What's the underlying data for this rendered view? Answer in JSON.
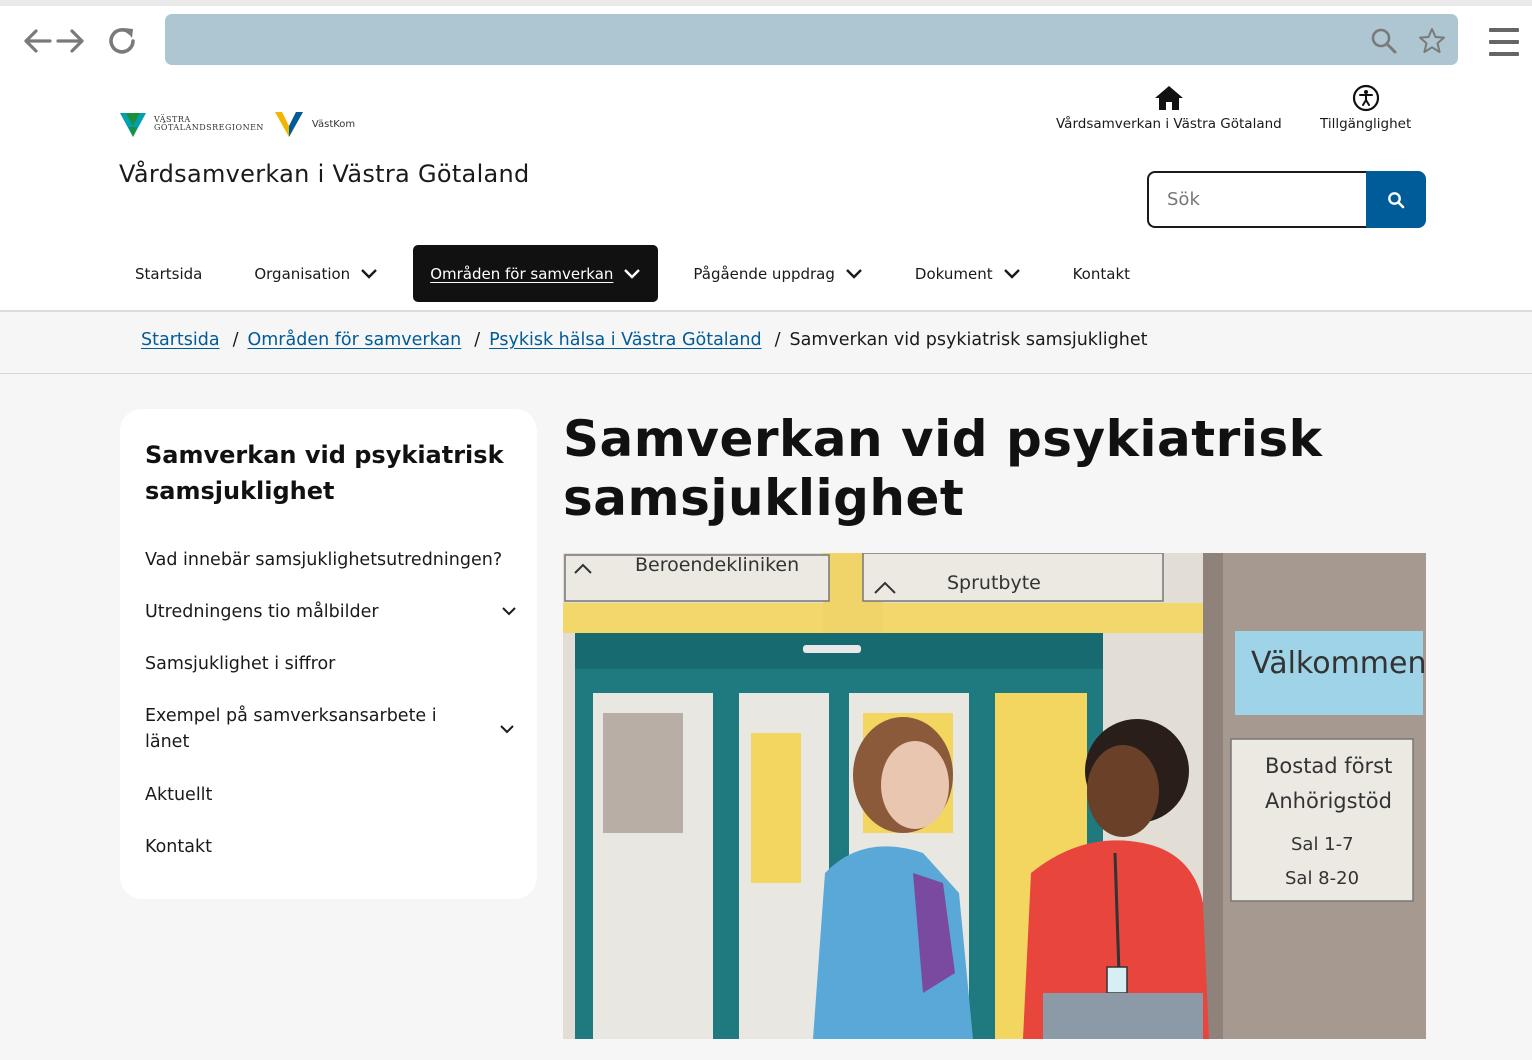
{
  "browser": {
    "back_icon": "arrow-left-icon",
    "forward_icon": "arrow-right-icon",
    "reload_icon": "reload-icon",
    "search_icon": "search-icon",
    "bookmark_icon": "star-icon",
    "menu_icon": "hamburger-icon"
  },
  "header": {
    "logo_vgr_line1": "VÄSTRA",
    "logo_vgr_line2": "GÖTALANDSREGIONEN",
    "logo_vastkom": "VästKom",
    "site_title": "Vårdsamverkan i Västra Götaland",
    "home_link": "Vårdsamverkan i Västra Götaland",
    "accessibility_link": "Tillgänglighet",
    "search_placeholder": "Sök"
  },
  "mainnav": {
    "items": [
      {
        "label": "Startsida"
      },
      {
        "label": "Organisation"
      },
      {
        "label": "Områden för samverkan"
      },
      {
        "label": "Pågående uppdrag"
      },
      {
        "label": "Dokument"
      },
      {
        "label": "Kontakt"
      }
    ]
  },
  "breadcrumb": {
    "items": [
      "Startsida",
      "Områden för samverkan",
      "Psykisk hälsa i Västra Götaland"
    ],
    "separator": "/",
    "current": "Samverkan vid psykiatrisk samsjuklighet"
  },
  "sidenav": {
    "title": "Samverkan vid psykiatrisk samsjuklighet",
    "items": [
      {
        "label": "Vad innebär samsjuklighetsutredningen?"
      },
      {
        "label": "Utredningens tio målbilder"
      },
      {
        "label": "Samsjuklighet i siffror"
      },
      {
        "label": "Exempel på samverksansarbete i länet"
      },
      {
        "label": "Aktuellt"
      },
      {
        "label": "Kontakt"
      }
    ]
  },
  "main": {
    "title": "Samverkan vid psykiatrisk samsjuklighet",
    "hero_signs": {
      "sign1": "Beroendekliniken",
      "sign2": "Sprutbyte",
      "welcome": "Välkommen",
      "sign3": "Bostad först",
      "sign4": "Anhörigstöd",
      "sign5": "Sal 1-7",
      "sign6": "Sal 8-20"
    }
  },
  "colors": {
    "brand_blue": "#005b99",
    "active_nav_bg": "#111111",
    "url_bar": "#aec6d2"
  }
}
